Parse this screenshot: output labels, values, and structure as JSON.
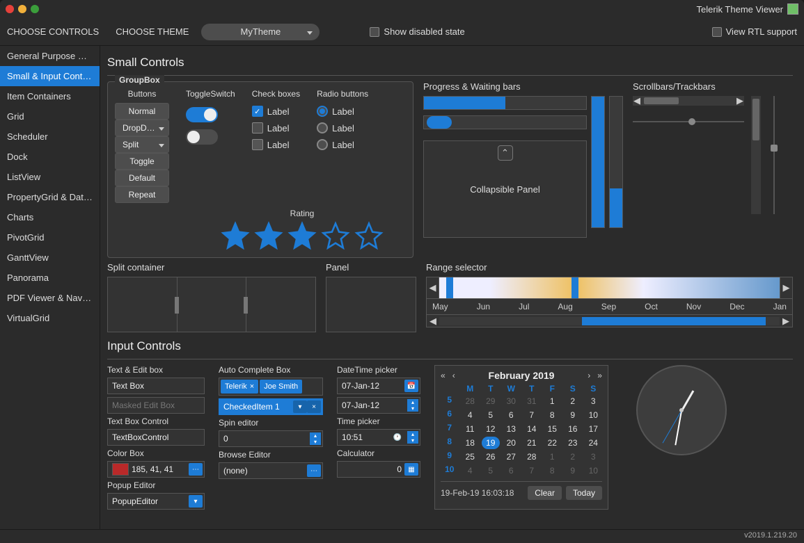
{
  "app_title": "Telerik Theme Viewer",
  "toolbar": {
    "choose_controls": "CHOOSE CONTROLS",
    "choose_theme": "CHOOSE THEME",
    "theme_name": "MyTheme",
    "show_disabled": "Show disabled state",
    "view_rtl": "View RTL support"
  },
  "sidebar": [
    "General Purpose C…",
    "Small & Input Contr…",
    "Item Containers",
    "Grid",
    "Scheduler",
    "Dock",
    "ListView",
    "PropertyGrid & Dat…",
    "Charts",
    "PivotGrid",
    "GanttView",
    "Panorama",
    "PDF Viewer & Navig…",
    "VirtualGrid"
  ],
  "sections": {
    "small_controls": "Small Controls",
    "input_controls": "Input Controls"
  },
  "groupbox": {
    "title": "GroupBox",
    "buttons_h": "Buttons",
    "buttons": [
      "Normal",
      "DropD…",
      "Split",
      "Toggle",
      "Default",
      "Repeat"
    ],
    "toggle_h": "ToggleSwitch",
    "checks_h": "Check boxes",
    "check_label": "Label",
    "radio_h": "Radio buttons",
    "radio_label": "Label",
    "rating_h": "Rating",
    "rating_value": 3,
    "rating_max": 5
  },
  "progress": {
    "head": "Progress & Waiting bars",
    "collapsible": "Collapsible Panel",
    "hvalue_pct": 50,
    "vvalue1_pct": 100,
    "vvalue2_pct": 30
  },
  "scrollbars": {
    "head": "Scrollbars/Trackbars"
  },
  "split": {
    "head": "Split container"
  },
  "panel": {
    "head": "Panel"
  },
  "range": {
    "head": "Range selector",
    "months": [
      "May",
      "Jun",
      "Jul",
      "Aug",
      "Sep",
      "Oct",
      "Nov",
      "Dec",
      "Jan"
    ]
  },
  "inputs": {
    "text_h": "Text & Edit box",
    "text_val": "Text Box",
    "masked_ph": "Masked Edit Box",
    "text_ctrl_h": "Text Box Control",
    "text_ctrl_val": "TextBoxControl",
    "color_h": "Color Box",
    "color_val": "185, 41, 41",
    "popup_h": "Popup Editor",
    "popup_val": "PopupEditor",
    "auto_h": "Auto Complete Box",
    "auto_tags": [
      "Telerik",
      "Joe Smith"
    ],
    "checked_val": "CheckedItem 1",
    "spin_h": "Spin editor",
    "spin_val": "0",
    "browse_h": "Browse Editor",
    "browse_val": "(none)",
    "dt_h": "DateTime picker",
    "dt_val": "07-Jan-12",
    "dt_val2": "07-Jan-12",
    "time_h": "Time picker",
    "time_val": "10:51",
    "calc_h": "Calculator",
    "calc_val": "0"
  },
  "calendar": {
    "title": "February 2019",
    "dow": [
      "M",
      "T",
      "W",
      "T",
      "F",
      "S",
      "S"
    ],
    "weeks": [
      {
        "wk": "5",
        "days": [
          {
            "n": 28,
            "o": true
          },
          {
            "n": 29,
            "o": true
          },
          {
            "n": 30,
            "o": true
          },
          {
            "n": 31,
            "o": true
          },
          {
            "n": 1
          },
          {
            "n": 2
          },
          {
            "n": 3
          }
        ]
      },
      {
        "wk": "6",
        "days": [
          {
            "n": 4
          },
          {
            "n": 5
          },
          {
            "n": 6
          },
          {
            "n": 7
          },
          {
            "n": 8
          },
          {
            "n": 9
          },
          {
            "n": 10
          }
        ]
      },
      {
        "wk": "7",
        "days": [
          {
            "n": 11
          },
          {
            "n": 12
          },
          {
            "n": 13
          },
          {
            "n": 14
          },
          {
            "n": 15
          },
          {
            "n": 16
          },
          {
            "n": 17
          }
        ]
      },
      {
        "wk": "8",
        "days": [
          {
            "n": 18
          },
          {
            "n": 19,
            "t": true
          },
          {
            "n": 20
          },
          {
            "n": 21
          },
          {
            "n": 22
          },
          {
            "n": 23
          },
          {
            "n": 24
          }
        ]
      },
      {
        "wk": "9",
        "days": [
          {
            "n": 25
          },
          {
            "n": 26
          },
          {
            "n": 27
          },
          {
            "n": 28
          },
          {
            "n": 1,
            "o": true
          },
          {
            "n": 2,
            "o": true
          },
          {
            "n": 3,
            "o": true
          }
        ]
      },
      {
        "wk": "10",
        "days": [
          {
            "n": 4,
            "o": true
          },
          {
            "n": 5,
            "o": true
          },
          {
            "n": 6,
            "o": true
          },
          {
            "n": 7,
            "o": true
          },
          {
            "n": 8,
            "o": true
          },
          {
            "n": 9,
            "o": true
          },
          {
            "n": 10,
            "o": true
          }
        ]
      }
    ],
    "footer_date": "19-Feb-19 16:03:18",
    "clear": "Clear",
    "today": "Today"
  },
  "footer_version": "v2019.1.219.20"
}
